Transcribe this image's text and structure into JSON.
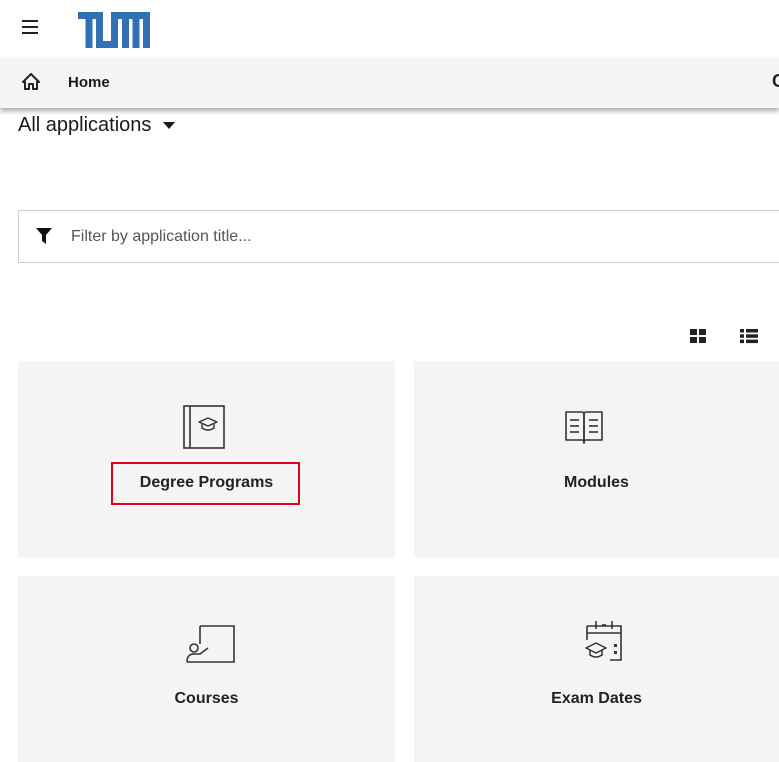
{
  "header": {
    "logo_text": "TUM",
    "brand_color": "#3070b3",
    "menu_icon": "hamburger-menu-icon"
  },
  "navbar": {
    "home_label": "Home",
    "home_icon": "home-icon",
    "right_glyph": "C"
  },
  "apps_select": {
    "label": "All applications"
  },
  "filter": {
    "placeholder": "Filter by application title...",
    "value": "",
    "icon": "filter-icon"
  },
  "view_toggle": {
    "grid_icon": "grid-view-icon",
    "list_icon": "list-view-icon"
  },
  "tiles": [
    {
      "label": "Degree Programs",
      "icon": "book-graduation-cap-icon"
    },
    {
      "label": "Modules",
      "icon": "open-book-icon"
    },
    {
      "label": "Courses",
      "icon": "teacher-board-icon"
    },
    {
      "label": "Exam Dates",
      "icon": "calendar-graduation-cap-icon"
    }
  ],
  "highlight_color": "#e0001a"
}
